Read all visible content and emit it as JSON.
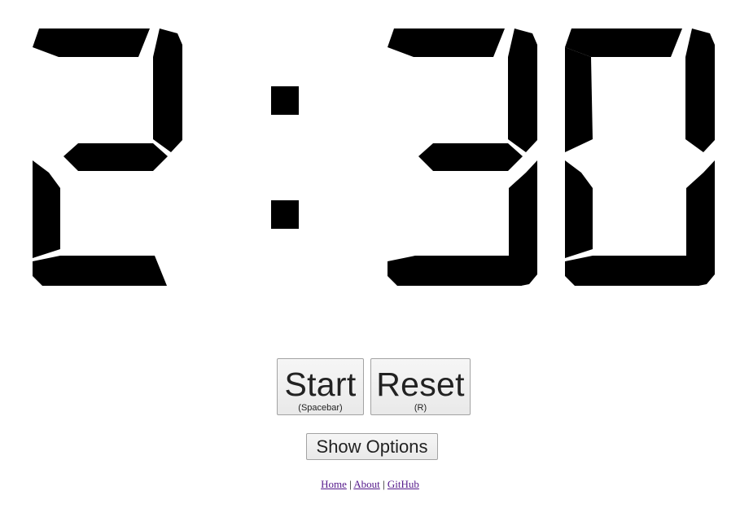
{
  "timer": {
    "minutes": "2",
    "colon": ":",
    "seconds_tens": "3",
    "seconds_ones": "0",
    "color": "#000000"
  },
  "controls": {
    "start": {
      "label": "Start",
      "shortcut": "(Spacebar)"
    },
    "reset": {
      "label": "Reset",
      "shortcut": "(R)"
    },
    "options_label": "Show Options"
  },
  "footer": {
    "links": [
      "Home",
      "About",
      "GitHub"
    ],
    "separator": "|",
    "link_color": "#551a8b"
  }
}
